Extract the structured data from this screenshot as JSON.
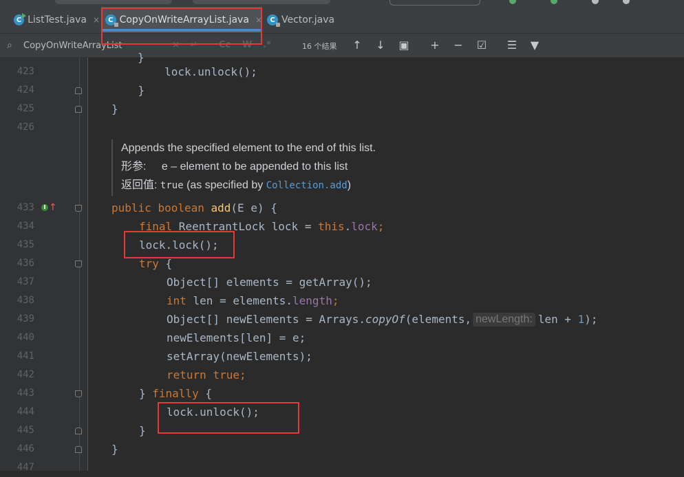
{
  "tabs": [
    {
      "label": "ListTest.java",
      "close": "×",
      "active": false
    },
    {
      "label": "CopyOnWriteArrayList.java",
      "close": "×",
      "active": true
    },
    {
      "label": "Vector.java",
      "close": "×",
      "active": false
    }
  ],
  "find": {
    "query": "CopyOnWriteArrayList",
    "clear": "×",
    "cc_toggle": "Cc",
    "words_toggle": "W",
    "regex_toggle": ".*",
    "result_count": "16 个结果",
    "icons": [
      "search-icon",
      "previous-occurrence-icon",
      "next-occurrence-icon",
      "select-all-occurrences-icon",
      "add-selection-icon",
      "remove-selection-icon",
      "select-all-icon",
      "in-selection-icon",
      "filter-icon"
    ]
  },
  "doc": {
    "summary": "Appends the specified element to the end of this list.",
    "param_label": "形参:",
    "param_text": "e – element to be appended to this list",
    "return_label": "返回值:",
    "return_code": "true",
    "return_pre": "(as specified by",
    "return_link": "Collection.add",
    "return_post": ")"
  },
  "lines": {
    "l423": "423",
    "l424": "424",
    "l425": "425",
    "l426": "426",
    "l433": "433",
    "l434": "434",
    "l435": "435",
    "l436": "436",
    "l437": "437",
    "l438": "438",
    "l439": "439",
    "l440": "440",
    "l441": "441",
    "l442": "442",
    "l443": "443",
    "l444": "444",
    "l445": "445",
    "l446": "446",
    "l447": "447"
  },
  "code": {
    "c423": "        lock.unlock();",
    "c424": "    }",
    "c425": "}",
    "c433_kw1": "public",
    "c433_kw2": "boolean",
    "c433_fn": "add",
    "c433_rest": "(E e) {",
    "c434_kw": "final",
    "c434_mid": " ReentrantLock lock = ",
    "c434_this": "this",
    "c434_dot": ".",
    "c434_fld": "lock",
    "c434_end": ";",
    "c435": "lock.lock();",
    "c436_kw": "try",
    "c436_rest": " {",
    "c437_pre": "Object[] elements = ",
    "c437_fn": "getArray",
    "c437_end": "();",
    "c438_kw": "int",
    "c438_mid": " len = elements.",
    "c438_fld": "length",
    "c438_end": ";",
    "c439_pre": "Object[] newElements = Arrays.",
    "c439_fn": "copyOf",
    "c439_mid": "(elements,",
    "c439_hint": "newLength:",
    "c439_post": "len + ",
    "c439_num": "1",
    "c439_end": ");",
    "c440": "newElements[len] = e;",
    "c441": "setArray(newElements);",
    "c442_kw1": "return",
    "c442_kw2": "true",
    "c442_end": ";",
    "c443_pre": "} ",
    "c443_kw": "finally",
    "c443_end": " {",
    "c444": "lock.unlock();",
    "c445": "}",
    "c446": "}"
  },
  "colors": {
    "background": "#2b2b2b",
    "keyword": "#cc7832",
    "method": "#ffc66d",
    "field": "#9876aa",
    "number": "#6897bb",
    "highlight_box": "#e53935",
    "active_tab_underline": "#4a88c7"
  }
}
